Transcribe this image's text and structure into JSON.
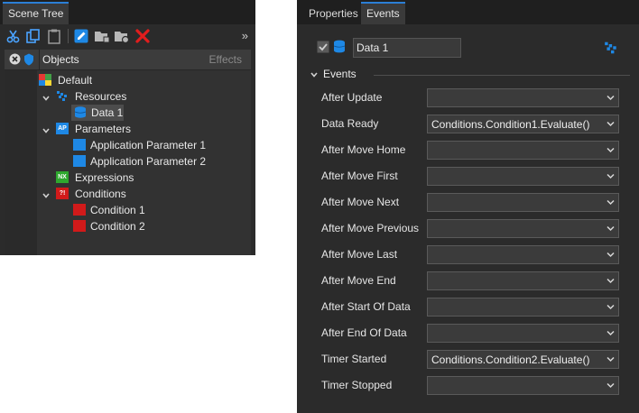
{
  "scene_tree": {
    "tab_label": "Scene Tree",
    "overflow_glyph": "»",
    "toolbar": [
      "cut-icon",
      "copy-icon",
      "paste-icon",
      "edit-icon",
      "new-folder-icon",
      "folder-settings-icon",
      "delete-icon"
    ],
    "header": {
      "objects": "Objects",
      "effects": "Effects"
    },
    "nodes": {
      "default": "Default",
      "resources": "Resources",
      "data1": "Data 1",
      "parameters": "Parameters",
      "parameters_badge": "AP",
      "app_param_1": "Application Parameter 1",
      "app_param_2": "Application Parameter 2",
      "expressions": "Expressions",
      "expressions_badge": "NX",
      "conditions": "Conditions",
      "conditions_badge": "?!",
      "condition1": "Condition 1",
      "condition2": "Condition 2"
    }
  },
  "properties": {
    "tabs": {
      "properties": "Properties",
      "events": "Events"
    },
    "name_value": "Data 1",
    "section_title": "Events",
    "events": [
      {
        "label": "After Update",
        "value": ""
      },
      {
        "label": "Data Ready",
        "value": "Conditions.Condition1.Evaluate()"
      },
      {
        "label": "After Move Home",
        "value": ""
      },
      {
        "label": "After Move First",
        "value": ""
      },
      {
        "label": "After Move Next",
        "value": ""
      },
      {
        "label": "After Move Previous",
        "value": ""
      },
      {
        "label": "After Move Last",
        "value": ""
      },
      {
        "label": "After Move End",
        "value": ""
      },
      {
        "label": "After Start Of Data",
        "value": ""
      },
      {
        "label": "After End Of Data",
        "value": ""
      },
      {
        "label": "Timer Started",
        "value": "Conditions.Condition2.Evaluate()"
      },
      {
        "label": "Timer Stopped",
        "value": ""
      }
    ]
  },
  "colors": {
    "accent": "#2b7fd6",
    "delete": "#e11d1d",
    "condition": "#d11a1a",
    "expression": "#2ea82e",
    "parameter": "#1e88e5"
  }
}
